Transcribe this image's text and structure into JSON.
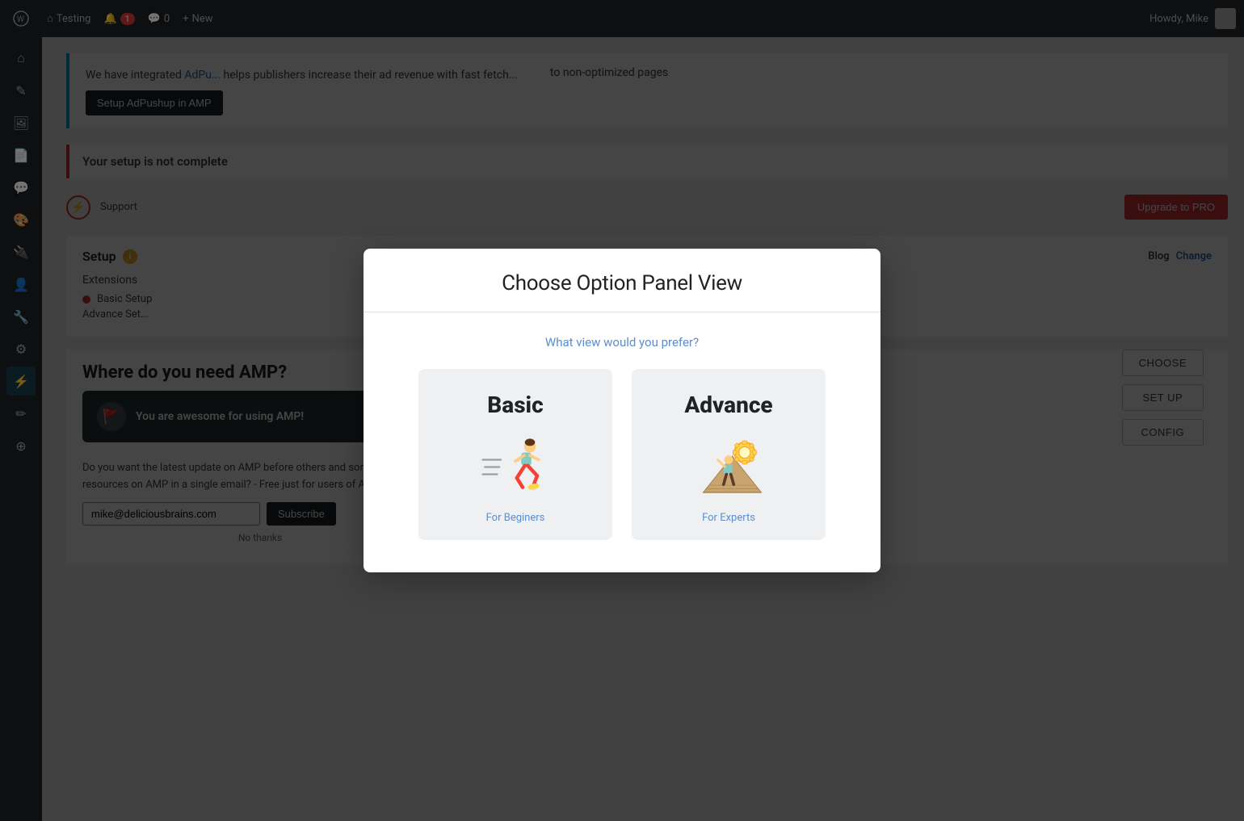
{
  "adminBar": {
    "logo": "⊞",
    "siteLabel": "Testing",
    "updates": "1",
    "comments": "0",
    "newLabel": "New",
    "greetingLabel": "Howdy, Mike"
  },
  "modal": {
    "title": "Choose Option Panel View",
    "subtitle": "What view would you prefer?",
    "options": [
      {
        "id": "basic",
        "title": "Basic",
        "description": "For Beginers"
      },
      {
        "id": "advance",
        "title": "Advance",
        "description": "For Experts"
      }
    ]
  },
  "background": {
    "adpushupText": "We have integrated AdPu...",
    "adpushupText2": "helps publishers increase their ad revenue with fast fetch...",
    "adpushupRight": "to non-optimized pages",
    "setupBtnLabel": "Setup AdPushup in AMP",
    "setupIncomplete": "Your setup is not complete",
    "setupTitle": "Setup",
    "blogLabel": "Blog",
    "changeLabel": "Change",
    "extensionsLabel": "Extensions",
    "basicSetupLabel": "Basic Setup",
    "advanceSetupLabel": "Advance Set...",
    "whereAmpTitle": "Where do you need AMP?",
    "notificationText": "You are awesome for using AMP!",
    "subscribeText": "Do you want the latest update on AMP before others and some best resources on AMP in a single email? - Free just for users of AMP!",
    "emailPlaceholder": "mike@deliciousbrains.com",
    "subscribeBtnLabel": "Subscribe",
    "noThanksLabel": "No thanks",
    "chooseBtnLabel": "CHOOSE",
    "setupBtnLabel2": "SET UP",
    "configBtnLabel": "CONFIG",
    "upgradeLabel": "Upgrade to PRO",
    "supportLabel": "Support"
  },
  "sidebar": {
    "icons": [
      "⌂",
      "🔔",
      "✏",
      "💬",
      "☰",
      "💬",
      "✏",
      "👤",
      "✏",
      "📋",
      "🔵",
      "✏",
      "⊕"
    ]
  }
}
